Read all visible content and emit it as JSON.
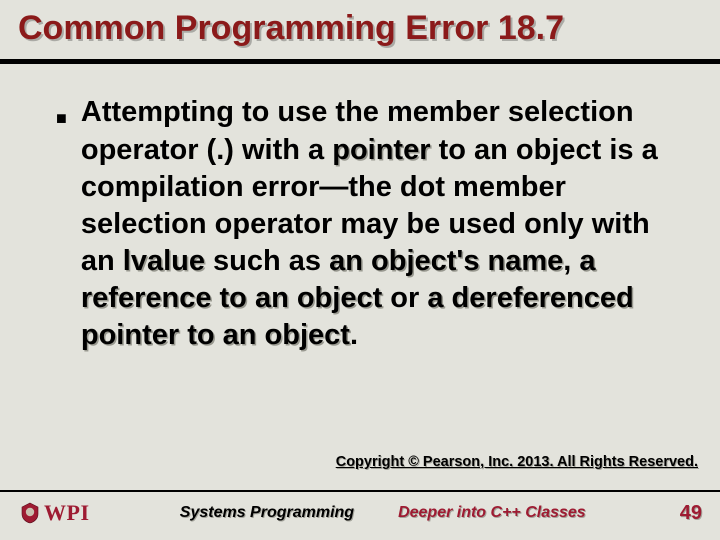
{
  "title": "Common Programming Error 18.7",
  "body": {
    "seg1": "Attempting to use the member selection operator (",
    "dot": ".",
    "seg2": ") with a ",
    "pointer": "pointer",
    "seg3": " to an object is a compilation error—the dot member selection operator may be used only with an ",
    "lvalue": "lvalue",
    "seg4": " such as ",
    "objname": "an object's name",
    "comma": ", ",
    "refobj": "a reference to an object",
    "or": " or ",
    "derefptr": "a dereferenced pointer to an object",
    "period": "."
  },
  "copyright": "Copyright © Pearson, Inc. 2013. All Rights Reserved.",
  "footer": {
    "logo_text": "WPI",
    "left": "Systems Programming",
    "right": "Deeper into C++ Classes",
    "page": "49"
  },
  "colors": {
    "accent": "#9e1b32",
    "title": "#8b1a1a",
    "bg": "#e3e3dc"
  }
}
